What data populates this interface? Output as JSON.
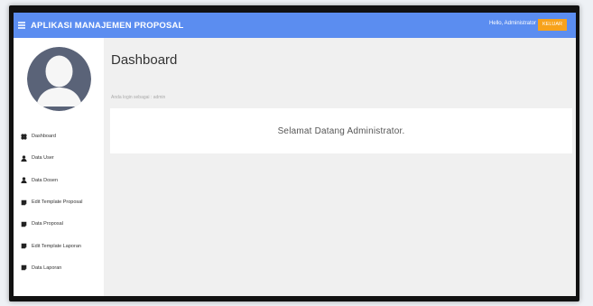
{
  "header": {
    "title": "APLIKASI MANAJEMEN PROPOSAL",
    "greeting": "Hello, Administrator",
    "logout_label": "KELUAR",
    "menu_icon": "hamburger-icon"
  },
  "sidebar": {
    "avatar_icon": "user-avatar-icon",
    "items": [
      {
        "label": "Dashboard",
        "icon": "dashboard-icon"
      },
      {
        "label": "Data User",
        "icon": "user-icon"
      },
      {
        "label": "Data Dosen",
        "icon": "user-icon"
      },
      {
        "label": "Edit Template Proposal",
        "icon": "file-icon"
      },
      {
        "label": "Data Proposal",
        "icon": "file-icon"
      },
      {
        "label": "Edit Template Laporan",
        "icon": "file-icon"
      },
      {
        "label": "Data Laporan",
        "icon": "file-icon"
      }
    ]
  },
  "main": {
    "page_title": "Dashboard",
    "login_info": "Anda login sebagai : admin",
    "welcome_message": "Selamat Datang Administrator."
  },
  "colors": {
    "topbar": "#5b8df0",
    "logout_button": "#f7a21b",
    "avatar_background": "#5a6378"
  }
}
